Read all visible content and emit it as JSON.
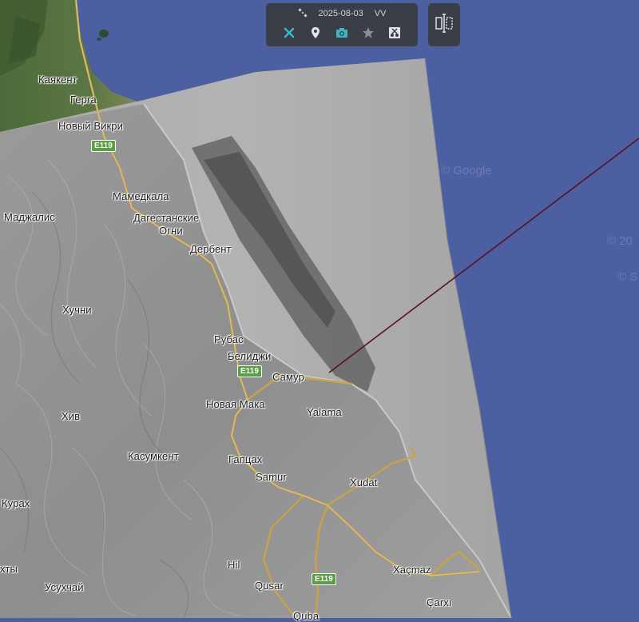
{
  "toolbar": {
    "date": "2025-08-03",
    "polarization": "VV",
    "satellite_icon": "satellite-icon",
    "buttons": [
      {
        "name": "satellite-tool",
        "icon": "satellite-icon",
        "color": "#3bb7c4"
      },
      {
        "name": "pin-tool",
        "icon": "map-pin-icon",
        "color": "#e0e3e8"
      },
      {
        "name": "camera-tool",
        "icon": "camera-icon",
        "color": "#3bb7c4"
      },
      {
        "name": "favorite-tool",
        "icon": "star-icon",
        "color": "#8a8f98"
      },
      {
        "name": "compare-tool",
        "icon": "scissors-icon",
        "color": "#e0e3e8"
      }
    ],
    "split_icon": "split-view-icon"
  },
  "watermark": {
    "google": "© Google",
    "partial_1": "© 20",
    "partial_2": "© S"
  },
  "roads": {
    "e119_label": "E119"
  },
  "places": {
    "kayakent": "Каякент",
    "gerga": "Герга",
    "novy_vikri": "Новый Викри",
    "mamedkala": "Мамедкала",
    "madzhalis": "Маджалис",
    "dag_ogni_1": "Дагестанские",
    "dag_ogni_2": "Огни",
    "derbent": "Дербент",
    "khuchni": "Хучни",
    "rubas": "Рубас",
    "belidzhi": "Белиджи",
    "samur_ru": "Самур",
    "novaya_maka": "Новая Мака",
    "yalama": "Yalama",
    "khiv": "Хив",
    "kasumkent": "Касумкент",
    "gaptsakh": "Гапцах",
    "samur_az": "Samur",
    "xudat": "Xudat",
    "kurakh": "Курах",
    "hil": "Hil",
    "akhty_partial": "хты",
    "usukhchay": "Усухчай",
    "qusar": "Qusar",
    "xacmaz": "Xaçmaz",
    "carxi": "Çarxı",
    "quba_partial": "Quba"
  }
}
